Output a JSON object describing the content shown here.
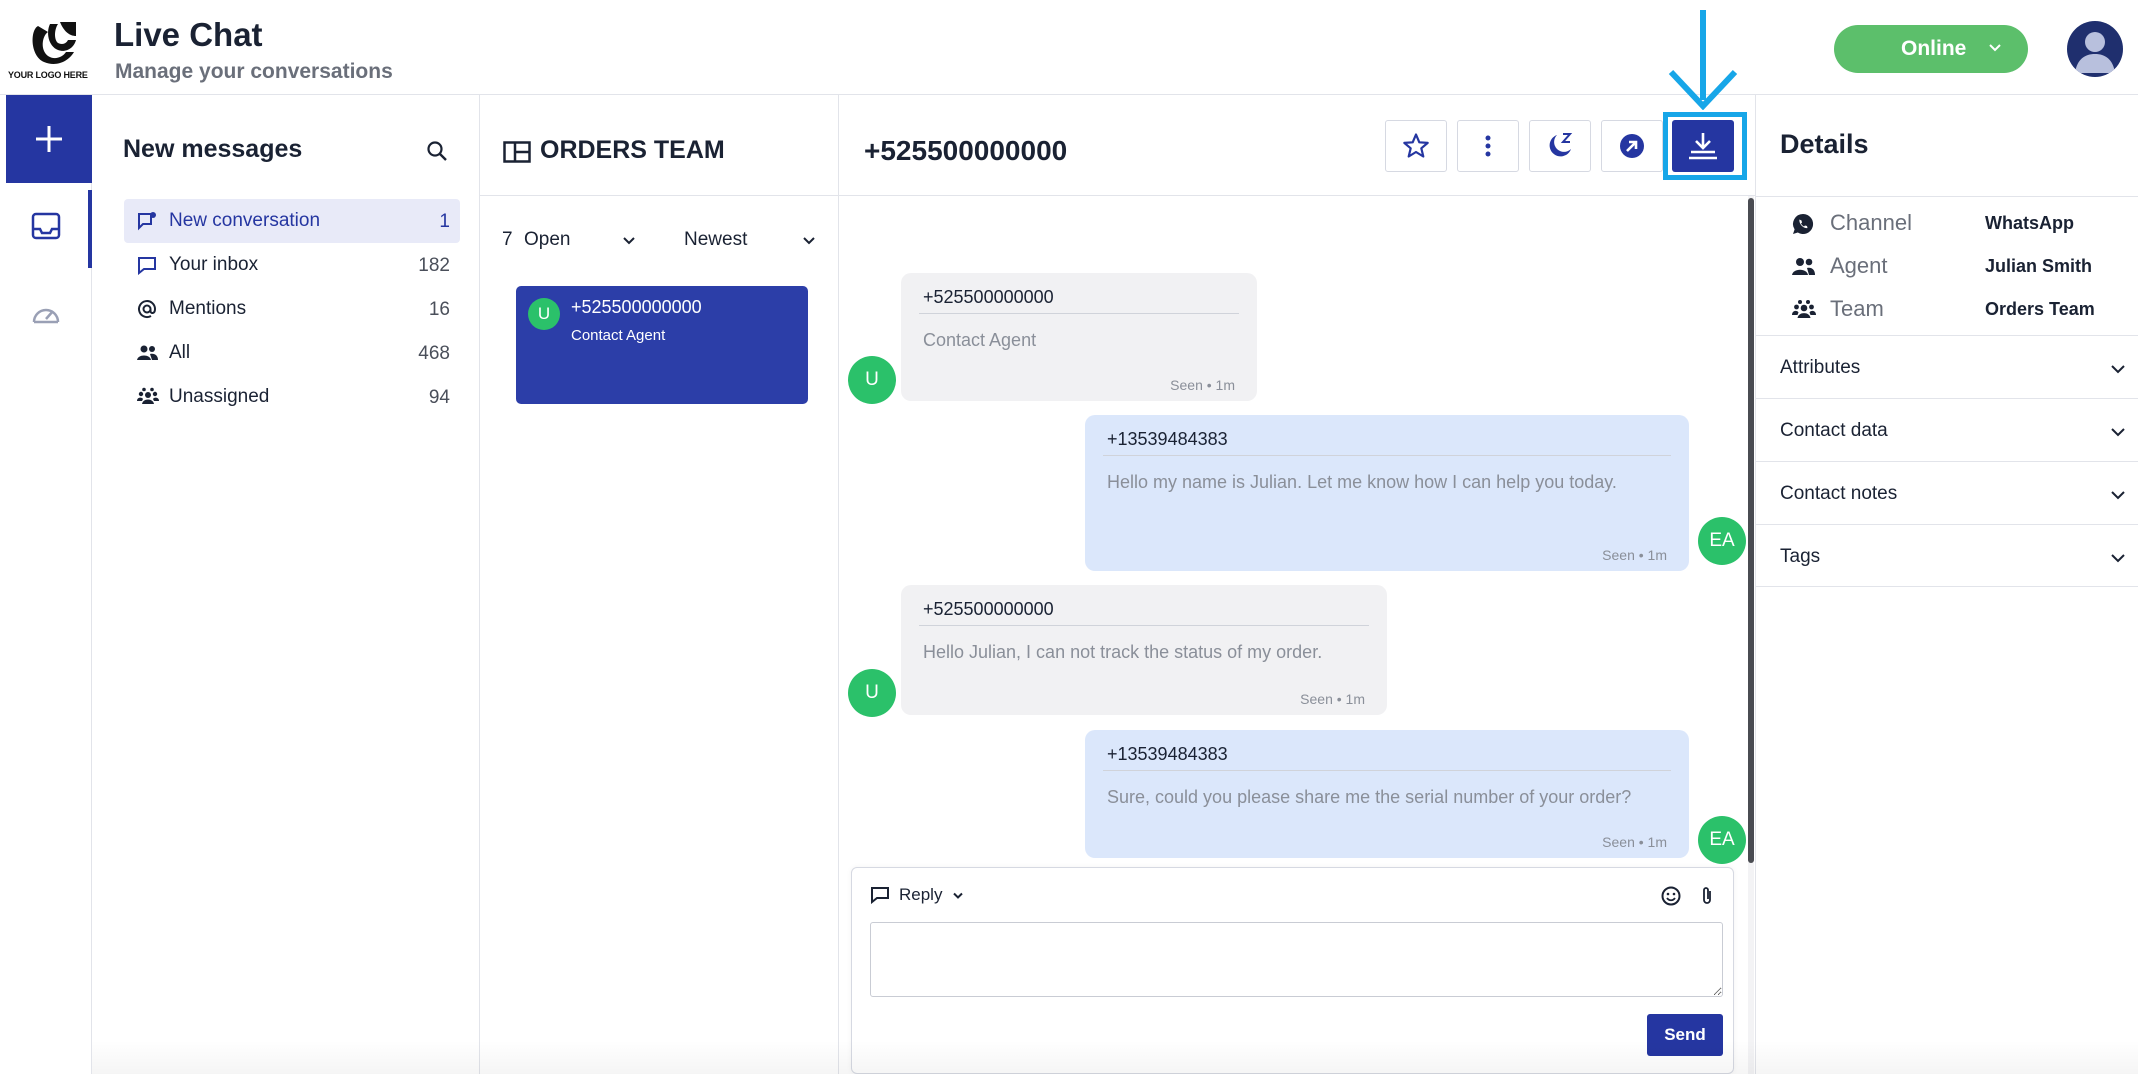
{
  "header": {
    "logo_text": "YOUR LOGO HERE",
    "title": "Live Chat",
    "subtitle": "Manage your conversations",
    "status": "Online"
  },
  "sidebar": {
    "title": "New messages",
    "items": [
      {
        "label": "New conversation",
        "count": "1",
        "icon": "new-chat-icon"
      },
      {
        "label": "Your inbox",
        "count": "182",
        "icon": "chat-bubble-icon"
      },
      {
        "label": "Mentions",
        "count": "16",
        "icon": "at-icon"
      },
      {
        "label": "All",
        "count": "468",
        "icon": "people-icon"
      },
      {
        "label": "Unassigned",
        "count": "94",
        "icon": "team-icon"
      }
    ]
  },
  "orders": {
    "title": "ORDERS TEAM",
    "open_count": "7",
    "open_label": "Open",
    "sort_label": "Newest",
    "conversation": {
      "avatar": "U",
      "name": "+525500000000",
      "subtitle": "Contact Agent"
    }
  },
  "chat": {
    "title": "+525500000000",
    "messages": [
      {
        "direction": "in",
        "sender": "+525500000000",
        "text": "Contact Agent",
        "status": "Seen",
        "time": "1m",
        "avatar": "U"
      },
      {
        "direction": "out",
        "sender": "+13539484383",
        "text": "Hello my name is Julian. Let me know how I can help you today.",
        "status": "Seen",
        "time": "1m",
        "avatar": "EA"
      },
      {
        "direction": "in",
        "sender": "+525500000000",
        "text": "Hello Julian, I can not track the status of my order.",
        "status": "Seen",
        "time": "1m",
        "avatar": "U"
      },
      {
        "direction": "out",
        "sender": "+13539484383",
        "text": "Sure, could you please share me the serial number of your order?",
        "status": "Seen",
        "time": "1m",
        "avatar": "EA"
      }
    ],
    "reply_label": "Reply",
    "send_label": "Send",
    "meta_separator": "•"
  },
  "details": {
    "title": "Details",
    "rows": [
      {
        "key": "Channel",
        "value": "WhatsApp",
        "icon": "whatsapp-icon"
      },
      {
        "key": "Agent",
        "value": "Julian Smith",
        "icon": "agent-icon"
      },
      {
        "key": "Team",
        "value": "Orders Team",
        "icon": "team-icon"
      }
    ],
    "sections": [
      "Attributes",
      "Contact data",
      "Contact notes",
      "Tags"
    ]
  },
  "colors": {
    "primary": "#2536a1",
    "online": "#5cbf6b",
    "avatar_green": "#2bc16a",
    "highlight": "#17a6e8"
  }
}
